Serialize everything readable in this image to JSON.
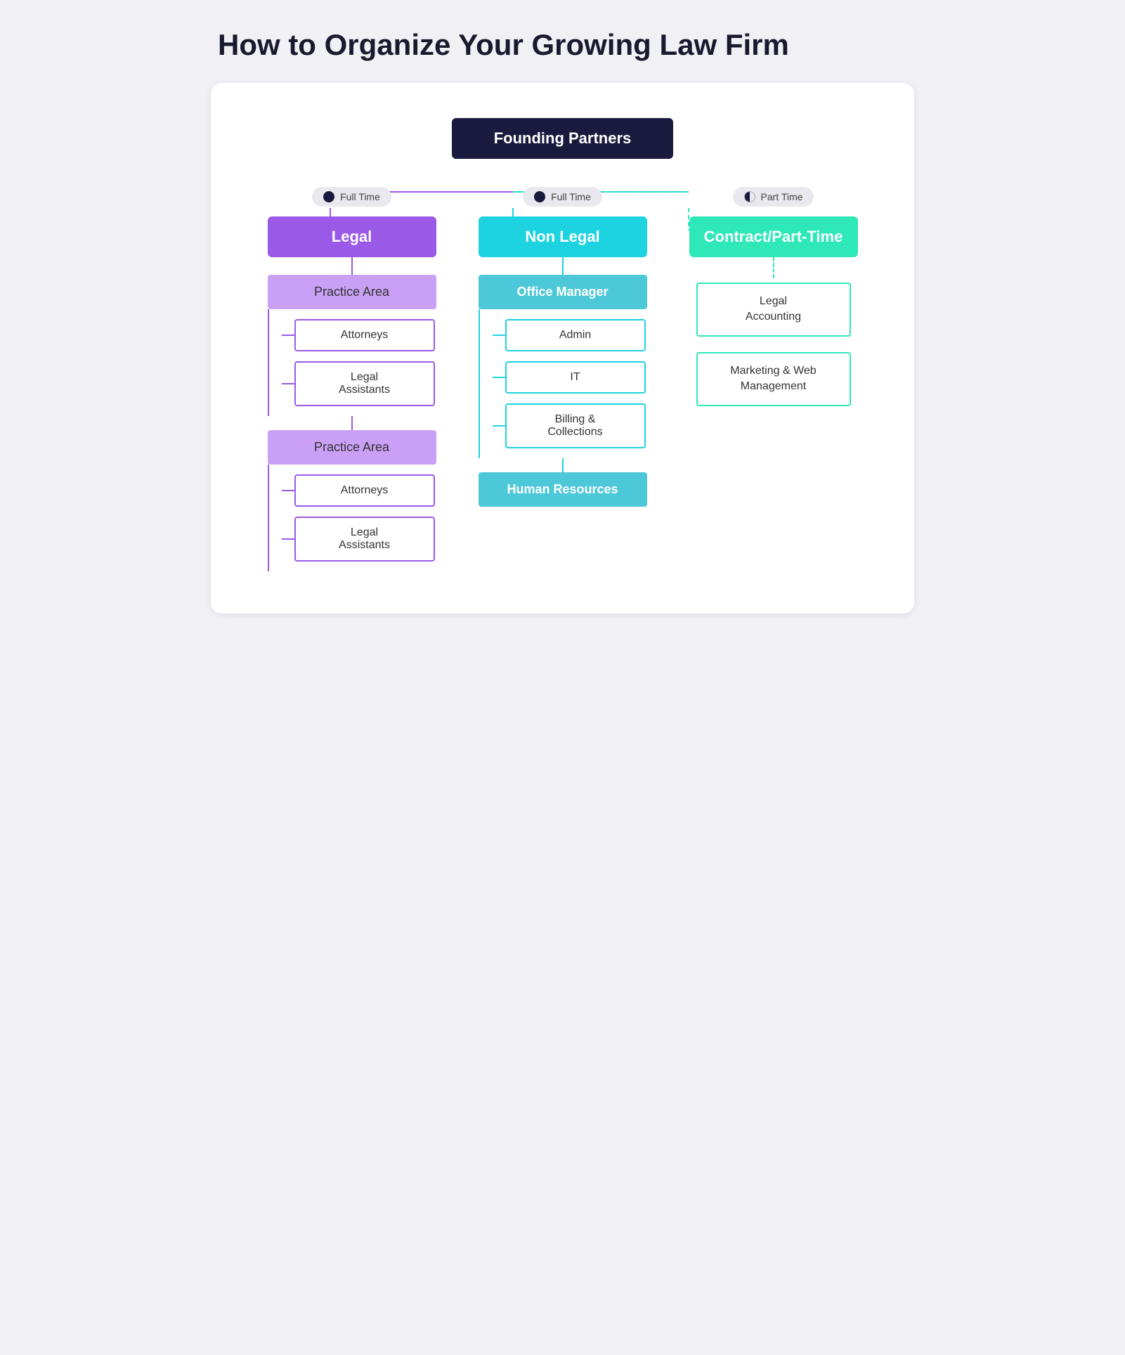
{
  "page": {
    "title": "How to Organize Your Growing Law Firm",
    "background_color": "#f0f0f5",
    "diagram_bg": "#ffffff"
  },
  "top_node": {
    "label": "Founding Partners",
    "bg_color": "#1a1a3e",
    "text_color": "#ffffff"
  },
  "columns": {
    "legal": {
      "badge": "Full Time",
      "header": "Legal",
      "header_bg": "#9b59e8",
      "practice_areas": [
        {
          "label": "Practice Area",
          "sub_items": [
            {
              "label": "Attorneys"
            },
            {
              "label": "Legal\nAssistants"
            }
          ]
        },
        {
          "label": "Practice Area",
          "sub_items": [
            {
              "label": "Attorneys"
            },
            {
              "label": "Legal\nAssistants"
            }
          ]
        }
      ]
    },
    "nonlegal": {
      "badge": "Full Time",
      "header": "Non Legal",
      "header_bg": "#1dd3e0",
      "office_manager": "Office Manager",
      "office_sub_items": [
        {
          "label": "Admin"
        },
        {
          "label": "IT"
        },
        {
          "label": "Billing &\nCollections"
        }
      ],
      "human_resources": "Human Resources"
    },
    "contract": {
      "badge": "Part Time",
      "header": "Contract/Part-Time",
      "header_bg": "#2ee8b8",
      "items": [
        {
          "label": "Legal\nAccounting"
        },
        {
          "label": "Marketing & Web\nManagement"
        }
      ]
    }
  }
}
